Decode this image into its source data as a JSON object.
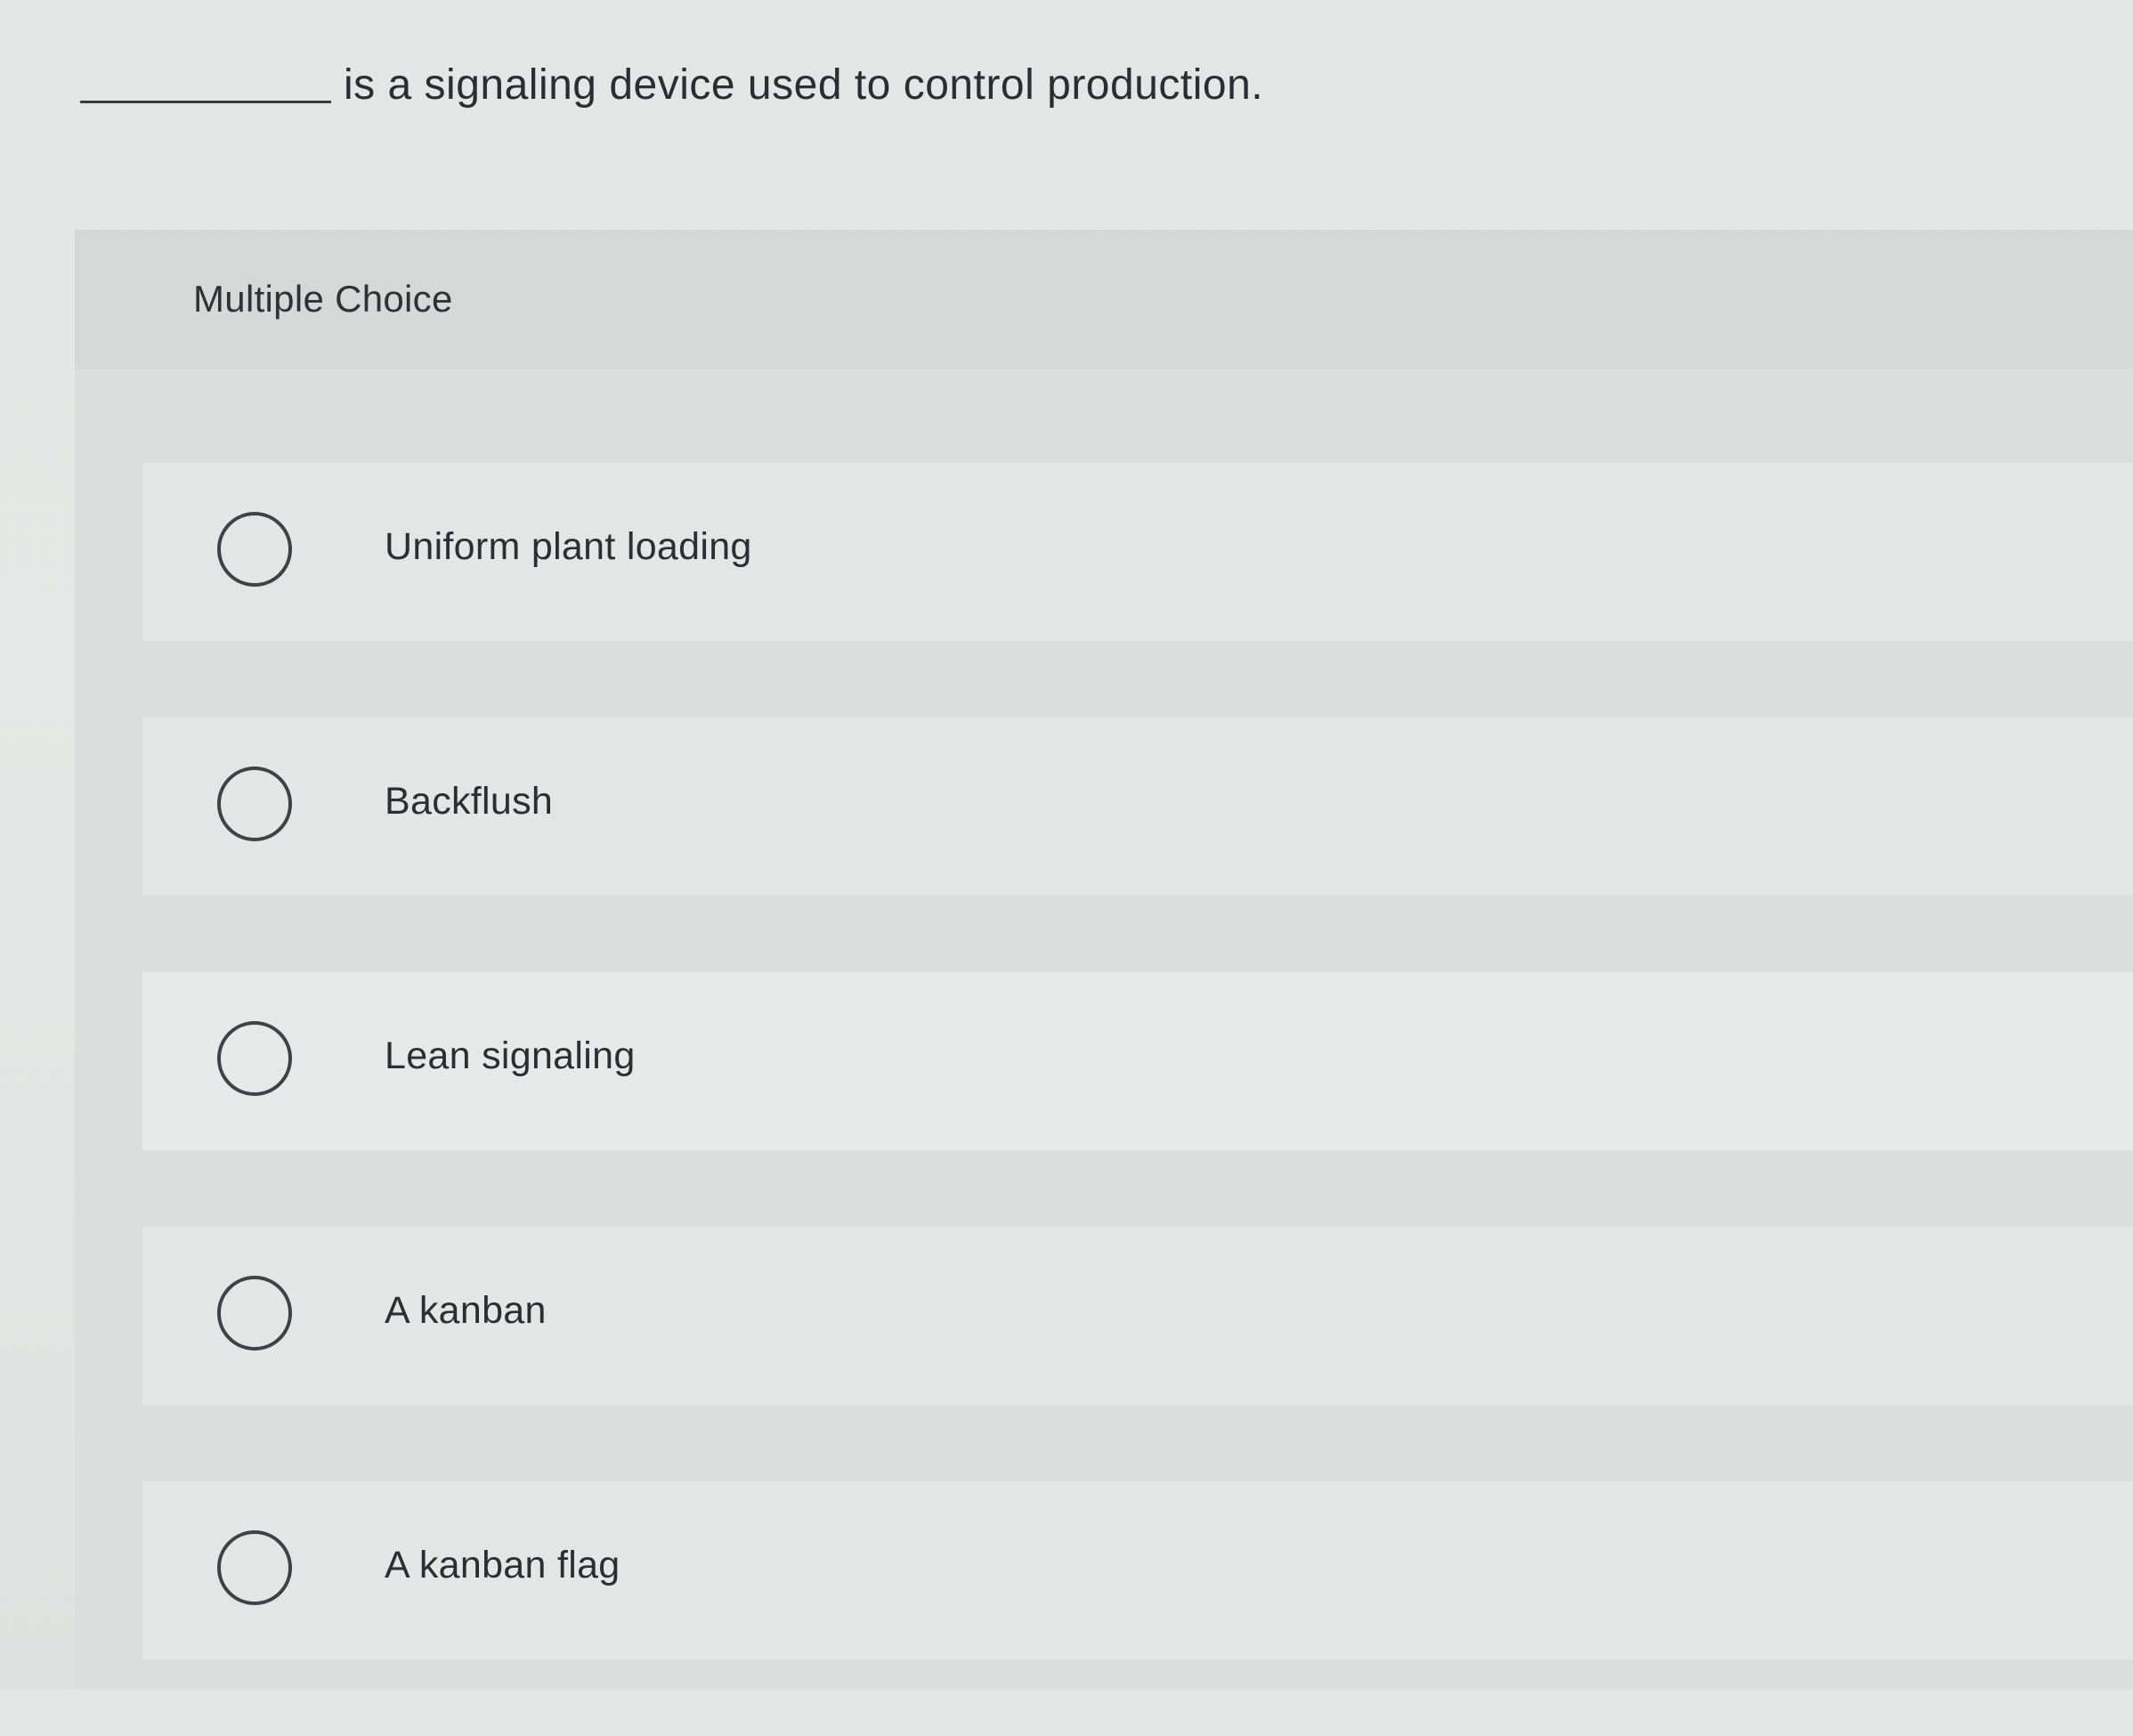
{
  "question": {
    "text": "is a signaling device used to control production."
  },
  "section": {
    "label": "Multiple Choice"
  },
  "choices": [
    {
      "label": "Uniform plant loading",
      "selected": false
    },
    {
      "label": "Backflush",
      "selected": false
    },
    {
      "label": "Lean signaling",
      "selected": false
    },
    {
      "label": "A kanban",
      "selected": false
    },
    {
      "label": "A kanban flag",
      "selected": false
    }
  ]
}
